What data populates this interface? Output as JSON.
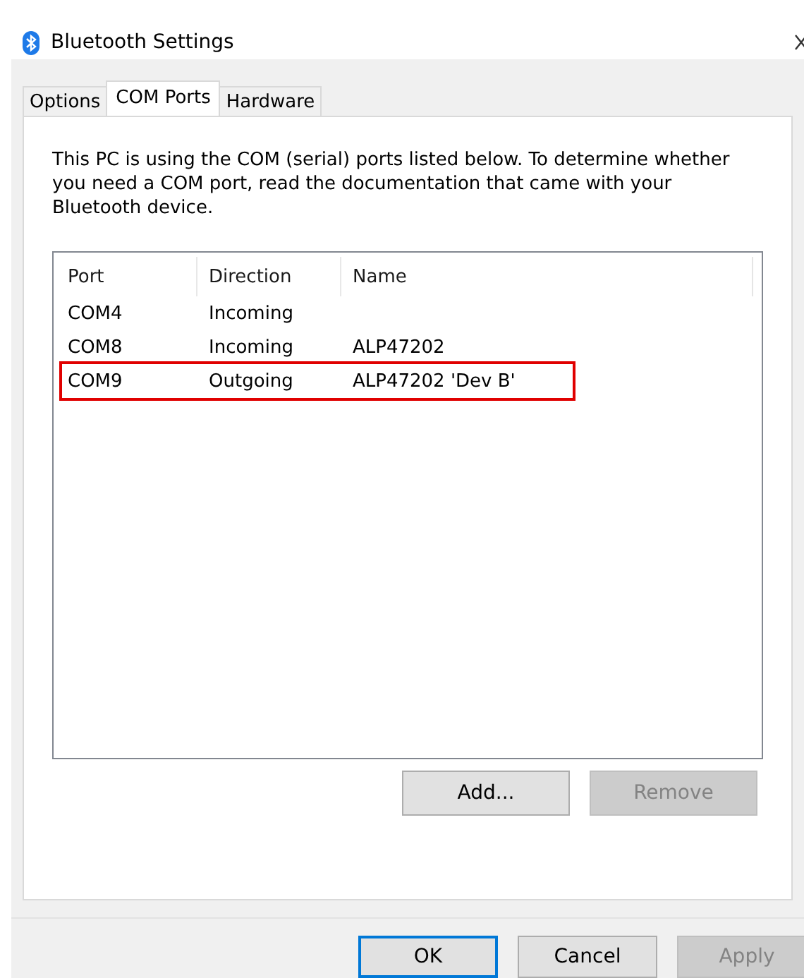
{
  "window": {
    "title": "Bluetooth Settings"
  },
  "tabs": [
    {
      "label": "Options",
      "selected": false
    },
    {
      "label": "COM Ports",
      "selected": true
    },
    {
      "label": "Hardware",
      "selected": false
    }
  ],
  "description": "This PC is using the COM (serial) ports listed below. To determine whether you need a COM port, read the documentation that came with your Bluetooth device.",
  "table": {
    "columns": [
      "Port",
      "Direction",
      "Name"
    ],
    "rows": [
      {
        "cells": [
          "COM4",
          "Incoming",
          ""
        ],
        "highlighted": false
      },
      {
        "cells": [
          "COM8",
          "Incoming",
          "ALP47202"
        ],
        "highlighted": false
      },
      {
        "cells": [
          "COM9",
          "Outgoing",
          "ALP47202 'Dev B'"
        ],
        "highlighted": true
      }
    ]
  },
  "list_buttons": [
    {
      "label": "Add...",
      "disabled": false
    },
    {
      "label": "Remove",
      "disabled": true
    }
  ],
  "dialog_buttons": [
    {
      "label": "OK",
      "disabled": false,
      "default": true
    },
    {
      "label": "Cancel",
      "disabled": false,
      "default": false
    },
    {
      "label": "Apply",
      "disabled": true,
      "default": false
    }
  ]
}
